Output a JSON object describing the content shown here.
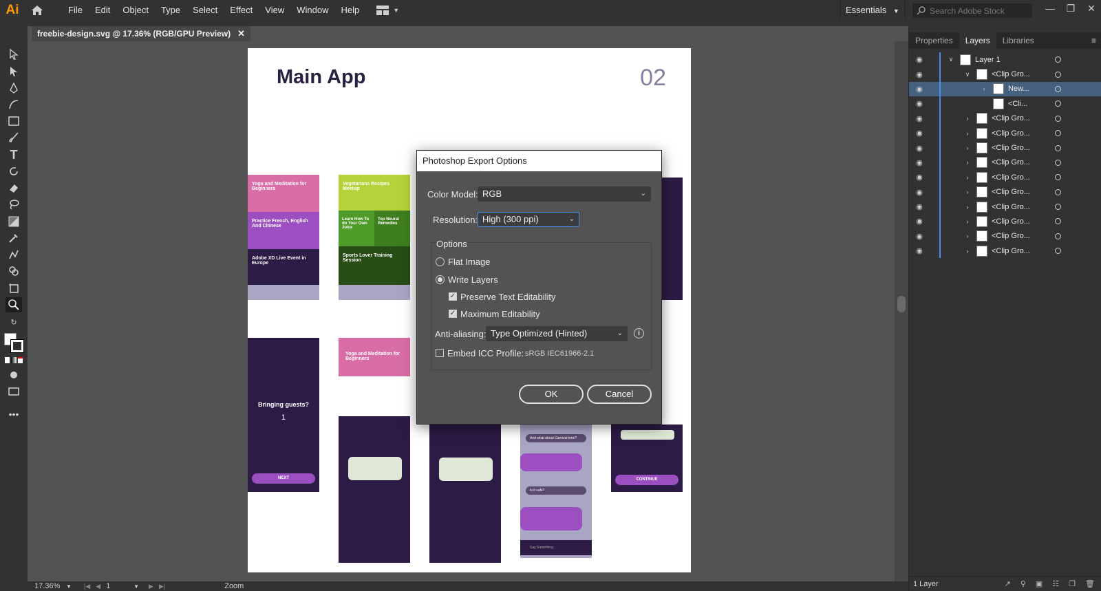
{
  "app": {
    "logo": "Ai"
  },
  "menu": {
    "items": [
      "File",
      "Edit",
      "Object",
      "Type",
      "Select",
      "Effect",
      "View",
      "Window",
      "Help"
    ]
  },
  "workspace": {
    "label": "Essentials"
  },
  "search": {
    "placeholder": "Search Adobe Stock"
  },
  "document": {
    "tab_label": "freebie-design.svg @ 17.36% (RGB/GPU Preview)"
  },
  "artboard": {
    "title": "Main App",
    "number": "02"
  },
  "mockups": {
    "card1": "Yoga and Meditation for Beginners",
    "card2": "Practice French, English And Chinese",
    "card3": "Adobe XD Live Event in Europe",
    "card4": "Vegetarians Recipes Meetup",
    "card5": "Learn How To do Your Own Juice",
    "card6": "Top Neural Remedies",
    "card7": "Sports Lover Training Session",
    "guests": "Bringing guests?",
    "guests_count": "1",
    "next": "NEXT",
    "continue": "CONTINUE",
    "yoga_detail": "Yoga and Meditation for Beginners",
    "chat1": "And what about Carnival time?",
    "chat2": "Is it safe?",
    "type_hint": "Say Something..."
  },
  "status": {
    "zoom": "17.36%",
    "artboard_num": "1",
    "tool": "Zoom"
  },
  "panel": {
    "tabs": [
      "Properties",
      "Layers",
      "Libraries"
    ],
    "layers": [
      {
        "name": "Layer 1"
      },
      {
        "name": "<Clip Gro..."
      },
      {
        "name": "New..."
      },
      {
        "name": "<Cli..."
      },
      {
        "name": "<Clip Gro..."
      },
      {
        "name": "<Clip Gro..."
      },
      {
        "name": "<Clip Gro..."
      },
      {
        "name": "<Clip Gro..."
      },
      {
        "name": "<Clip Gro..."
      },
      {
        "name": "<Clip Gro..."
      },
      {
        "name": "<Clip Gro..."
      },
      {
        "name": "<Clip Gro..."
      },
      {
        "name": "<Clip Gro..."
      },
      {
        "name": "<Clip Gro..."
      }
    ],
    "footer": "1 Layer"
  },
  "dialog": {
    "title": "Photoshop Export Options",
    "color_model_label": "Color Model:",
    "color_model_value": "RGB",
    "resolution_label": "Resolution:",
    "resolution_value": "High (300 ppi)",
    "options_label": "Options",
    "flat_image": "Flat Image",
    "write_layers": "Write Layers",
    "preserve_text": "Preserve Text Editability",
    "max_edit": "Maximum Editability",
    "antialias_label": "Anti-aliasing:",
    "antialias_value": "Type Optimized (Hinted)",
    "embed_icc": "Embed ICC Profile:",
    "icc_profile": "sRGB IEC61966-2.1",
    "ok": "OK",
    "cancel": "Cancel"
  }
}
